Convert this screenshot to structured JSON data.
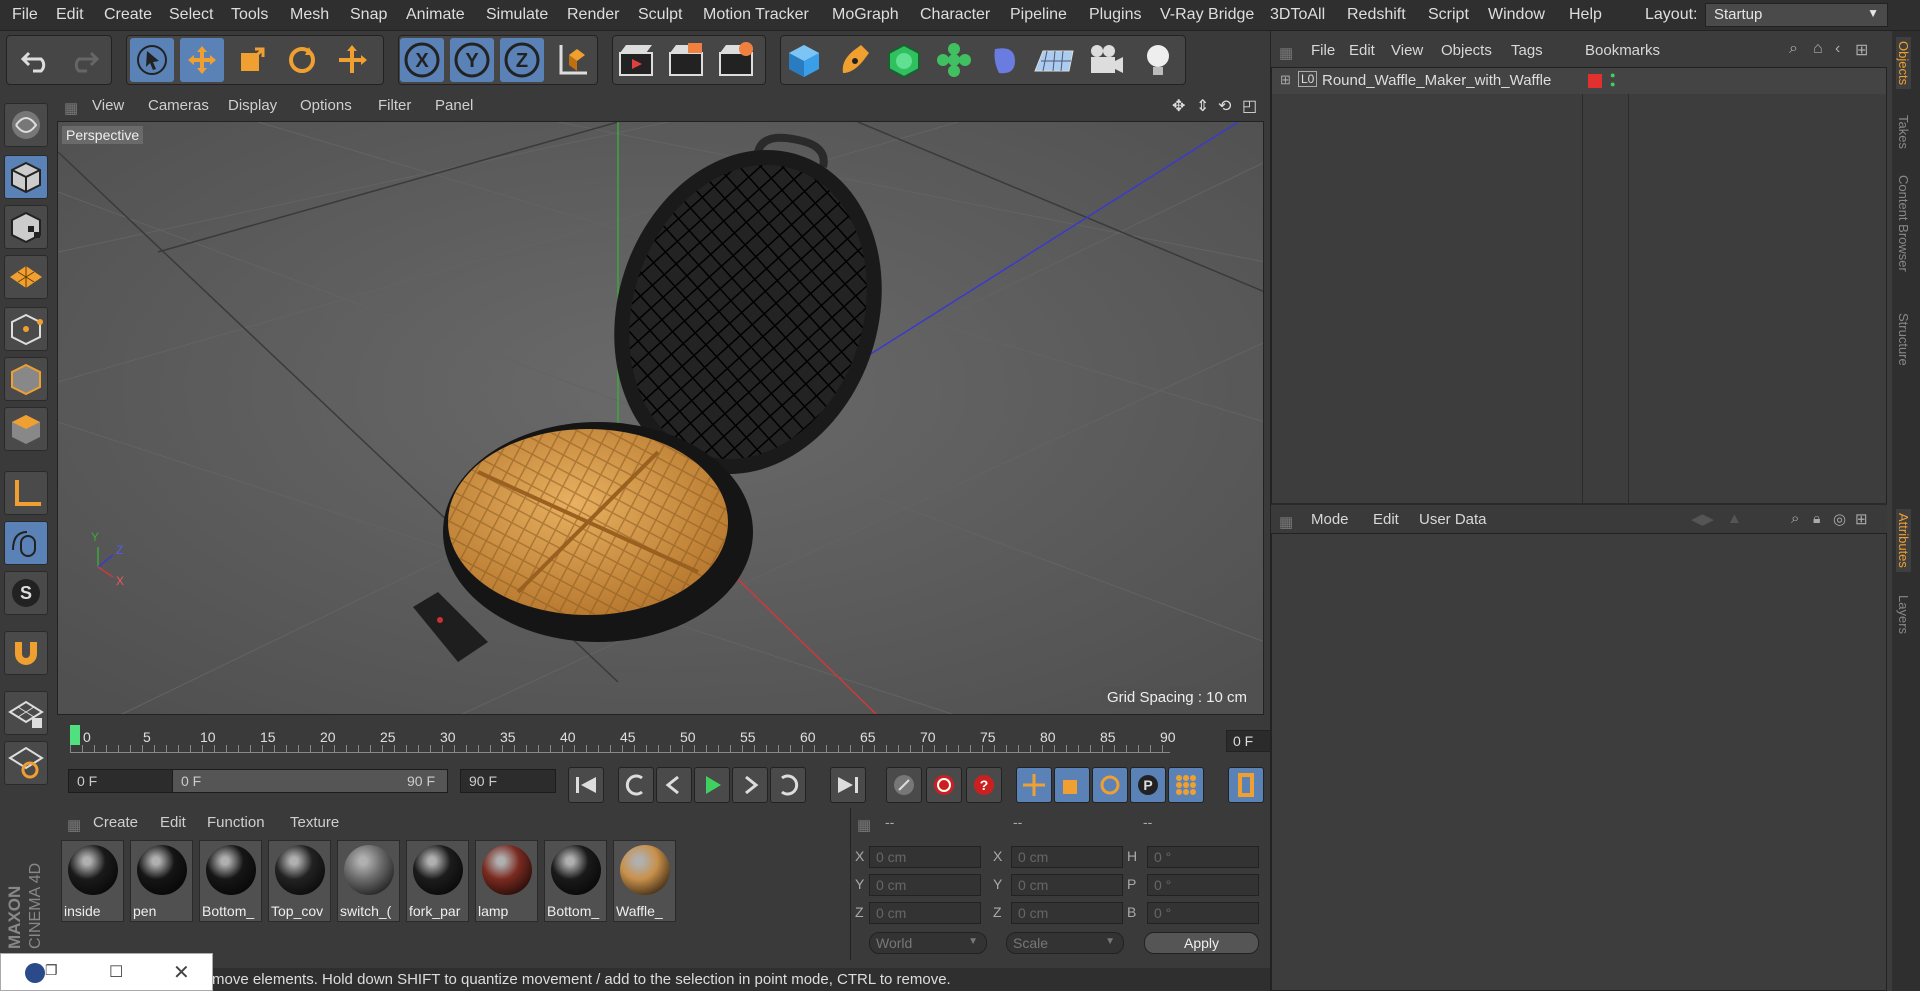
{
  "menubar": {
    "items": [
      "File",
      "Edit",
      "Create",
      "Select",
      "Tools",
      "Mesh",
      "Snap",
      "Animate",
      "Simulate",
      "Render",
      "Sculpt",
      "Motion Tracker",
      "MoGraph",
      "Character",
      "Pipeline",
      "Plugins",
      "V-Ray Bridge",
      "3DToAll",
      "Redshift",
      "Script",
      "Window",
      "Help"
    ],
    "layout_label": "Layout:",
    "layout_value": "Startup"
  },
  "toolbar": {
    "axis_x": "X",
    "axis_y": "Y",
    "axis_z": "Z"
  },
  "viewport": {
    "menu": [
      "View",
      "Cameras",
      "Display",
      "Options",
      "Filter",
      "Panel"
    ],
    "camera_label": "Perspective",
    "grid_spacing": "Grid Spacing : 10 cm",
    "axis_y": "Y",
    "axis_z": "Z",
    "axis_x": "X"
  },
  "timeline": {
    "ticks": [
      "0",
      "5",
      "10",
      "15",
      "20",
      "25",
      "30",
      "35",
      "40",
      "45",
      "50",
      "55",
      "60",
      "65",
      "70",
      "75",
      "80",
      "85",
      "90"
    ],
    "current_frame": "0 F"
  },
  "playback": {
    "start_field": "0 F",
    "range_start": "0 F",
    "range_end": "90 F",
    "end_field": "90 F"
  },
  "materials": {
    "menu": [
      "Create",
      "Edit",
      "Function",
      "Texture"
    ],
    "items": [
      {
        "label": "inside",
        "color": "#1a1a1a"
      },
      {
        "label": "pen",
        "color": "#151515"
      },
      {
        "label": "Bottom_",
        "color": "#161616"
      },
      {
        "label": "Top_cov",
        "color": "#222222"
      },
      {
        "label": "switch_(",
        "color": "#6c6c6c"
      },
      {
        "label": "fork_par",
        "color": "#1c1c1c"
      },
      {
        "label": "lamp",
        "color": "#7a2a20"
      },
      {
        "label": "Bottom_",
        "color": "#1a1a1a"
      },
      {
        "label": "Waffle_",
        "color": "#c8904a"
      }
    ]
  },
  "coords": {
    "headers": [
      "--",
      "--",
      "--"
    ],
    "rows": [
      {
        "a": "X",
        "av": "0 cm",
        "b": "X",
        "bv": "0 cm",
        "c": "H",
        "cv": "0 °"
      },
      {
        "a": "Y",
        "av": "0 cm",
        "b": "Y",
        "bv": "0 cm",
        "c": "P",
        "cv": "0 °"
      },
      {
        "a": "Z",
        "av": "0 cm",
        "b": "Z",
        "bv": "0 cm",
        "c": "B",
        "cv": "0 °"
      }
    ],
    "world": "World",
    "scale": "Scale",
    "apply": "Apply"
  },
  "status": {
    "text": "move elements. Hold down SHIFT to quantize movement / add to the selection in point mode, CTRL to remove."
  },
  "objects": {
    "menu": [
      "File",
      "Edit",
      "View",
      "Objects",
      "Tags",
      "Bookmarks"
    ],
    "items": [
      {
        "name": "Round_Waffle_Maker_with_Waffle",
        "layer_label": "L0",
        "tag_color": "#e03030"
      }
    ]
  },
  "attributes": {
    "menu": [
      "Mode",
      "Edit",
      "User Data"
    ]
  },
  "sidetabs": {
    "top": [
      "Objects",
      "Takes",
      "Content Browser",
      "Structure"
    ],
    "bottom": [
      "Attributes",
      "Layers"
    ]
  },
  "branding": {
    "maxon": "MAXON",
    "product": "CINEMA 4D"
  },
  "colors": {
    "accent": "#5a82b6",
    "orange": "#f0a030",
    "tl_marker": "#50e080"
  }
}
